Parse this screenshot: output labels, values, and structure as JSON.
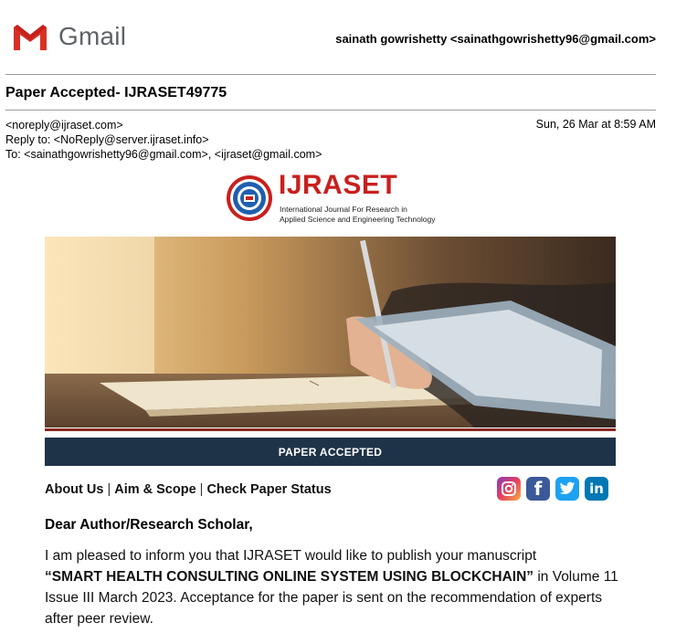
{
  "gmail": {
    "product": "Gmail",
    "account": "sainath gowrishetty <sainathgowrishetty96@gmail.com>"
  },
  "email": {
    "subject": "Paper Accepted- IJRASET49775",
    "from": "<noreply@ijraset.com>",
    "reply_to": "Reply to: <NoReply@server.ijraset.info>",
    "to": "To: <sainathgowrishetty96@gmail.com>, <ijraset@gmail.com>",
    "date": "Sun, 26 Mar at 8:59 AM"
  },
  "brand": {
    "name": "IJRASET",
    "tagline_line1": "International Journal For Research in",
    "tagline_line2": "Applied Science and Engineering Technology",
    "color": "#c8201e"
  },
  "banner": {
    "label": "PAPER ACCEPTED",
    "color": "#1e3347"
  },
  "nav": {
    "about": "About Us",
    "aim": "Aim & Scope",
    "status": "Check Paper Status",
    "sep": "|"
  },
  "socials": [
    {
      "name": "instagram-icon"
    },
    {
      "name": "facebook-icon",
      "glyph": "f"
    },
    {
      "name": "twitter-icon"
    },
    {
      "name": "linkedin-icon",
      "glyph": "in"
    }
  ],
  "body": {
    "greeting": "Dear Author/Research Scholar,",
    "intro": "I am pleased to inform you that IJRASET would like to publish your manuscript",
    "title": "“SMART HEALTH CONSULTING ONLINE SYSTEM USING BLOCKCHAIN”",
    "rest": " in Volume 11 Issue III March 2023. Acceptance for the paper is sent on the recommendation of experts after peer review."
  }
}
